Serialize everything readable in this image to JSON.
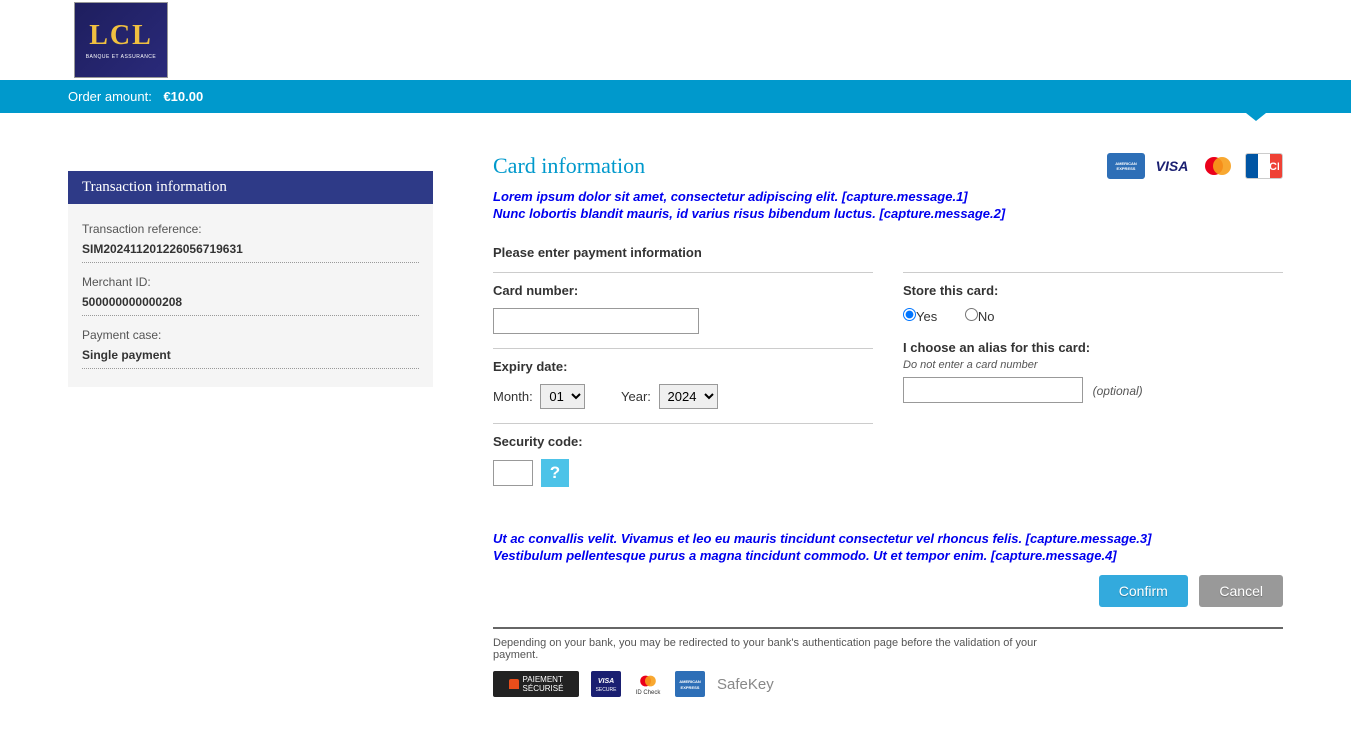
{
  "logo": {
    "text": "LCL",
    "subtext": "BANQUE ET ASSURANCE"
  },
  "order_bar": {
    "label": "Order amount:",
    "amount": "€10.00"
  },
  "sidebar": {
    "title": "Transaction information",
    "items": [
      {
        "label": "Transaction reference:",
        "value": "SIM202411201226056719631"
      },
      {
        "label": "Merchant ID:",
        "value": "500000000000208"
      },
      {
        "label": "Payment case:",
        "value": "Single payment"
      }
    ]
  },
  "main": {
    "title": "Card information",
    "capture_messages_top": [
      "Lorem ipsum dolor sit amet, consectetur adipiscing elit. [capture.message.1]",
      "Nunc lobortis blandit mauris, id varius risus bibendum luctus. [capture.message.2]"
    ],
    "instruction": "Please enter payment information",
    "card_number_label": "Card number:",
    "expiry_label": "Expiry date:",
    "month_label": "Month:",
    "year_label": "Year:",
    "month_value": "01",
    "year_value": "2024",
    "cvv_label": "Security code:",
    "store_label": "Store this card:",
    "yes_label": "Yes",
    "no_label": "No",
    "alias_label": "I choose an alias for this card:",
    "alias_hint": "Do not enter a card number",
    "optional_label": "(optional)",
    "capture_messages_bottom": [
      "Ut ac convallis velit. Vivamus et leo eu mauris tincidunt consectetur vel rhoncus felis. [capture.message.3]",
      "Vestibulum pellentesque purus a magna tincidunt commodo. Ut et tempor enim. [capture.message.4]"
    ],
    "confirm_label": "Confirm",
    "cancel_label": "Cancel",
    "redirect_note": "Depending on your bank, you may be redirected to your bank's authentication page before the validation of your payment.",
    "safekey_label": "SafeKey"
  }
}
